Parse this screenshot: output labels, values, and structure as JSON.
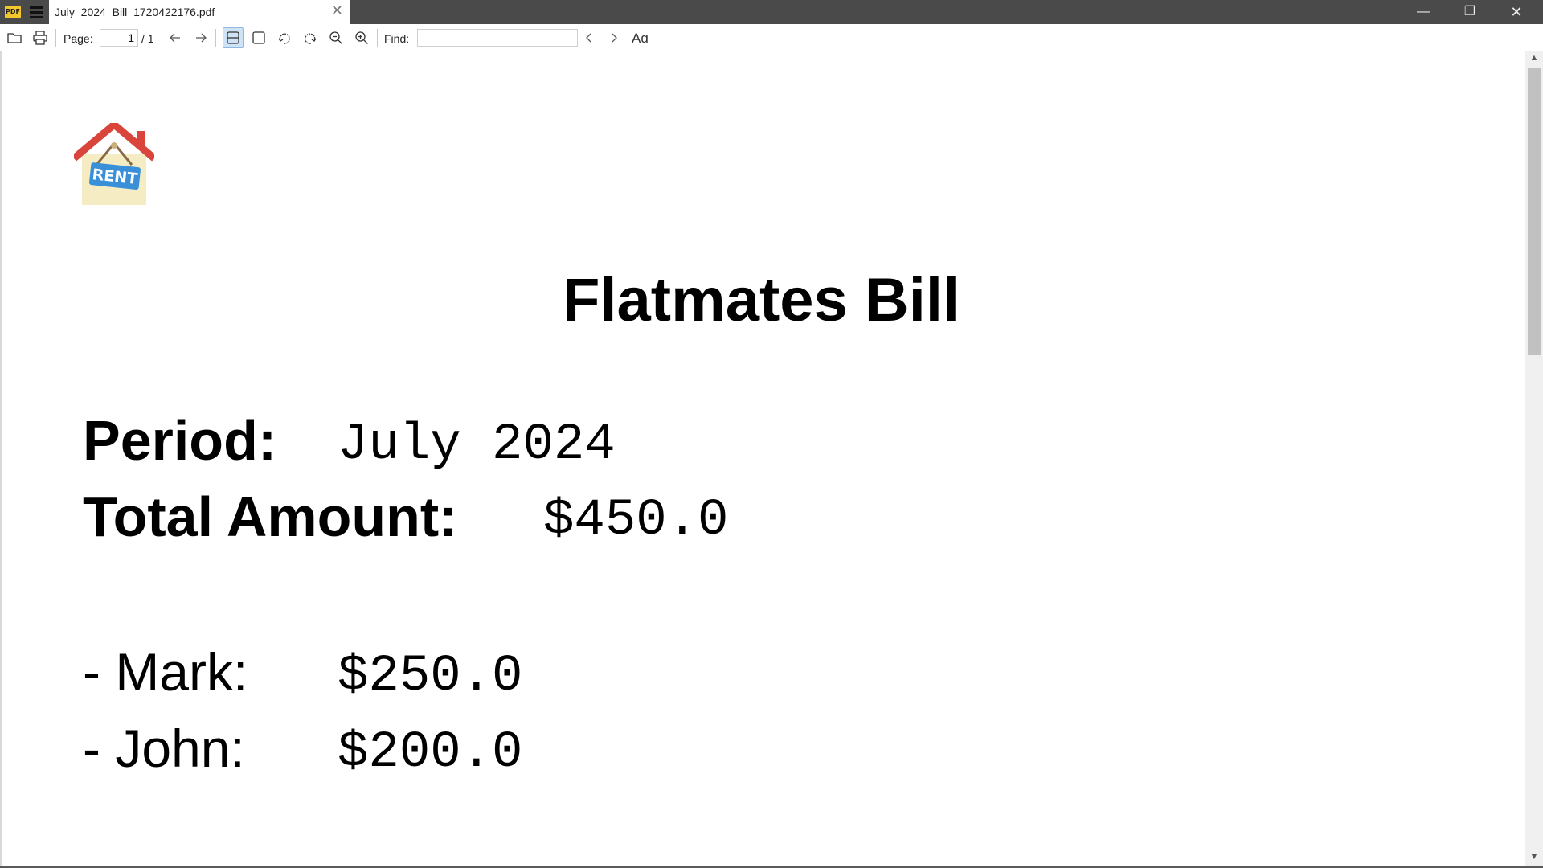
{
  "window": {
    "app_logo": "PDF",
    "tab_title": "July_2024_Bill_1720422176.pdf",
    "tab_close": "✕",
    "minimize": "—",
    "maximize": "❐",
    "close": "✕"
  },
  "toolbar": {
    "page_label": "Page:",
    "page_current": "1",
    "page_total": "/ 1",
    "find_label": "Find:",
    "find_value": "",
    "match_case_label": "Aɑ",
    "icons": [
      "open-folder-icon",
      "print-icon",
      "prev-page-icon",
      "next-page-icon",
      "fit-width-icon",
      "fit-page-icon",
      "rotate-left-icon",
      "rotate-right-icon",
      "zoom-out-icon",
      "zoom-in-icon",
      "find-prev-icon",
      "find-next-icon"
    ]
  },
  "document": {
    "image_text": "RENT",
    "title": "Flatmates Bill",
    "period_label": "Period:",
    "period_value": "July 2024",
    "total_label": "Total Amount:",
    "total_value": "$450.0",
    "flatmates": [
      {
        "name": "- Mark:",
        "amount": "$250.0"
      },
      {
        "name": "- John:",
        "amount": "$200.0"
      }
    ]
  },
  "colors": {
    "titlebar": "#4a4a4a",
    "active_toggle": "#cfe3f7",
    "roof": "#d9453a",
    "rent_sign": "#3a8fd9"
  }
}
